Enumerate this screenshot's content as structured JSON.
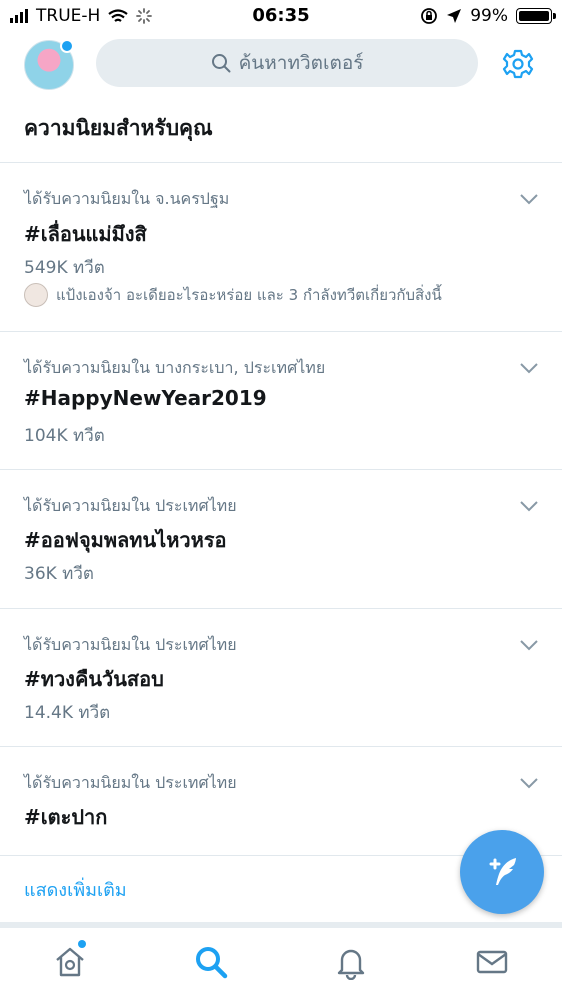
{
  "status": {
    "carrier": "TRUE-H",
    "time": "06:35",
    "battery": "99%",
    "battery_level": 0.99
  },
  "header": {
    "search_placeholder": "ค้นหาทวิตเตอร์"
  },
  "section_title": "ความนิยมสำหรับคุณ",
  "trends": [
    {
      "context": "ได้รับความนิยมใน จ.นครปฐม",
      "tag": "#เลื่อนแม่มึงสิ",
      "count": "549K ทวีต",
      "who": "แป้งเองจ้า อะเดียอะไรอะหร่อย และ 3 กำลังทวีตเกี่ยวกับสิ่งนี้"
    },
    {
      "context": "ได้รับความนิยมใน บางกระเบา, ประเทศไทย",
      "tag": "#HappyNewYear2019",
      "count": "104K ทวีต"
    },
    {
      "context": "ได้รับความนิยมใน ประเทศไทย",
      "tag": "#ออฟจุมพลทนไหวหรอ",
      "count": "36K ทวีต"
    },
    {
      "context": "ได้รับความนิยมใน ประเทศไทย",
      "tag": "#ทวงคืนวันสอบ",
      "count": "14.4K ทวีต"
    },
    {
      "context": "ได้รับความนิยมใน ประเทศไทย",
      "tag": "#เตะปาก"
    }
  ],
  "show_more": "แสดงเพิ่มเติม",
  "icons": {
    "signal": "signal-bars-icon",
    "wifi": "wifi-icon",
    "loading": "activity-spinner-icon",
    "orientation_lock": "orientation-lock-icon",
    "location": "location-arrow-icon",
    "search": "search-icon",
    "settings": "gear-icon",
    "chevron": "chevron-down-icon",
    "compose": "compose-tweet-icon",
    "home": "home-icon",
    "explore": "search-icon",
    "notifications": "bell-icon",
    "messages": "mail-icon"
  },
  "colors": {
    "accent": "#1da1f2",
    "fab": "#4aa1eb",
    "muted": "#657786",
    "divider": "#e1e8ed"
  }
}
